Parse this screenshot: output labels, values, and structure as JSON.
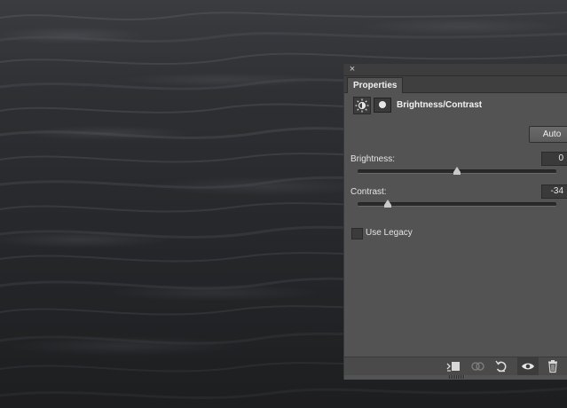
{
  "panel": {
    "close_glyph": "×",
    "tab_label": "Properties",
    "adjustment_title": "Brightness/Contrast",
    "auto_label": "Auto",
    "brightness": {
      "label": "Brightness:",
      "value": "0",
      "slider_fraction": 0.5
    },
    "contrast": {
      "label": "Contrast:",
      "value": "-34",
      "slider_fraction": 0.15
    },
    "use_legacy": {
      "label": "Use Legacy",
      "checked": false
    }
  },
  "footer_icons": [
    "clip-to-layer-icon",
    "view-previous-state-icon",
    "reset-icon",
    "visibility-eye-icon",
    "trash-icon"
  ],
  "colors": {
    "panel_bg": "#535353",
    "tab_bar_bg": "#3f3f3f",
    "text": "#e4e4e4",
    "thumb": "#c9c9c9"
  }
}
